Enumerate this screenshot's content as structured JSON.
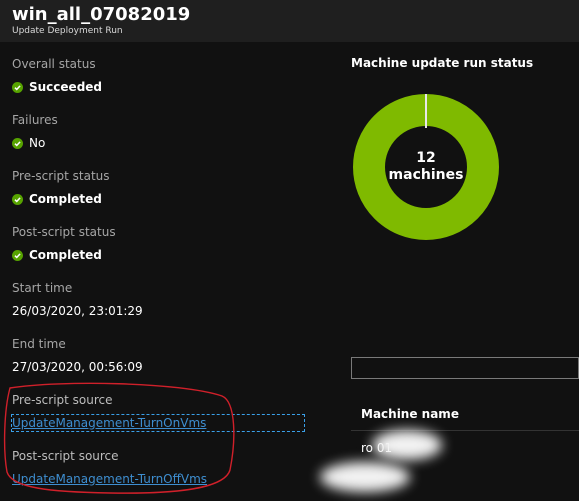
{
  "header": {
    "title": "win_all_07082019",
    "subtitle": "Update Deployment Run"
  },
  "fields": {
    "overall_status": {
      "label": "Overall status",
      "value": "Succeeded"
    },
    "failures": {
      "label": "Failures",
      "value": "No"
    },
    "pre_script_status": {
      "label": "Pre-script status",
      "value": "Completed"
    },
    "post_script_status": {
      "label": "Post-script status",
      "value": "Completed"
    },
    "start_time": {
      "label": "Start time",
      "value": "26/03/2020, 23:01:29"
    },
    "end_time": {
      "label": "End time",
      "value": "27/03/2020, 00:56:09"
    },
    "pre_script_source": {
      "label": "Pre-script source",
      "value": "UpdateManagement-TurnOnVms"
    },
    "post_script_source": {
      "label": "Post-script source",
      "value": "UpdateManagement-TurnOffVms"
    }
  },
  "colors": {
    "success_green": "#57a300",
    "donut_green": "#7fba00",
    "link_blue": "#3e8ed0",
    "annotation_red": "#d0202a"
  },
  "chart": {
    "title": "Machine update run status",
    "count": "12",
    "unit": "machines"
  },
  "chart_data": {
    "type": "pie",
    "values": [
      12
    ],
    "colors": [
      "#7fba00"
    ],
    "total": 12
  },
  "machines_table": {
    "column_header": "Machine name",
    "rows": [
      {
        "name_visible": "ro           01"
      }
    ]
  },
  "icons": {
    "status": "check-circle-icon"
  }
}
